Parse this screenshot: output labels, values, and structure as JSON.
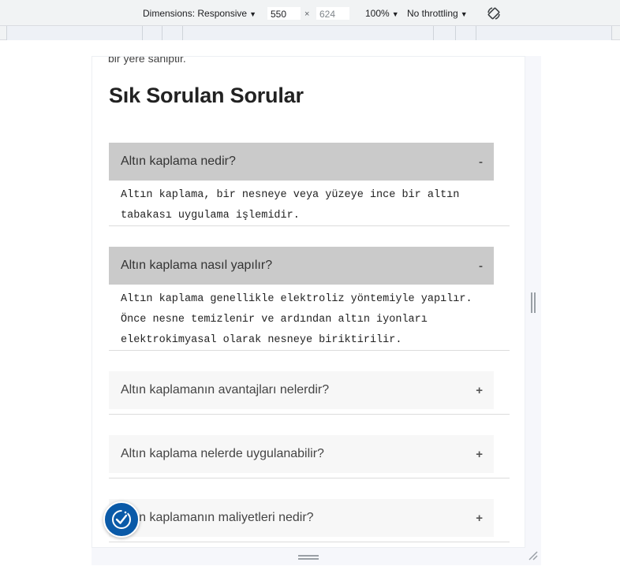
{
  "devtools": {
    "dimensions_label": "Dimensions: Responsive",
    "width_value": "550",
    "height_value": "624",
    "times_symbol": "×",
    "zoom_label": "100%",
    "throttling_label": "No throttling",
    "caret": "▼"
  },
  "page": {
    "cut_text": "bir yere sahiptir.",
    "faq_title": "Sık Sorulan Sorular",
    "faq": [
      {
        "question": "Altın kaplama nedir?",
        "symbol": "-",
        "open": true,
        "answer_lines": [
          "Altın kaplama, bir nesneye veya yüzeye ince bir altın",
          "tabakası uygulama işlemidir."
        ]
      },
      {
        "question": "Altın kaplama nasıl yapılır?",
        "symbol": "-",
        "open": true,
        "answer_lines": [
          "Altın kaplama genellikle elektroliz yöntemiyle yapılır.",
          "Önce nesne temizlenir ve ardından altın iyonları",
          "elektrokimyasal olarak nesneye biriktirilir."
        ]
      },
      {
        "question": "Altın kaplamanın avantajları nelerdir?",
        "symbol": "+",
        "open": false
      },
      {
        "question": "Altın kaplama nelerde uygulanabilir?",
        "symbol": "+",
        "open": false
      },
      {
        "question": "Altın kaplamanın maliyetleri nedir?",
        "symbol": "+",
        "open": false
      }
    ]
  },
  "icons": {
    "rotate": "rotate-icon",
    "accessibility": "accessibility-icon"
  },
  "colors": {
    "open_question_bg": "#cacaca",
    "closed_question_bg": "#f7f7f7",
    "accessibility_bg": "#0a5aa8"
  }
}
